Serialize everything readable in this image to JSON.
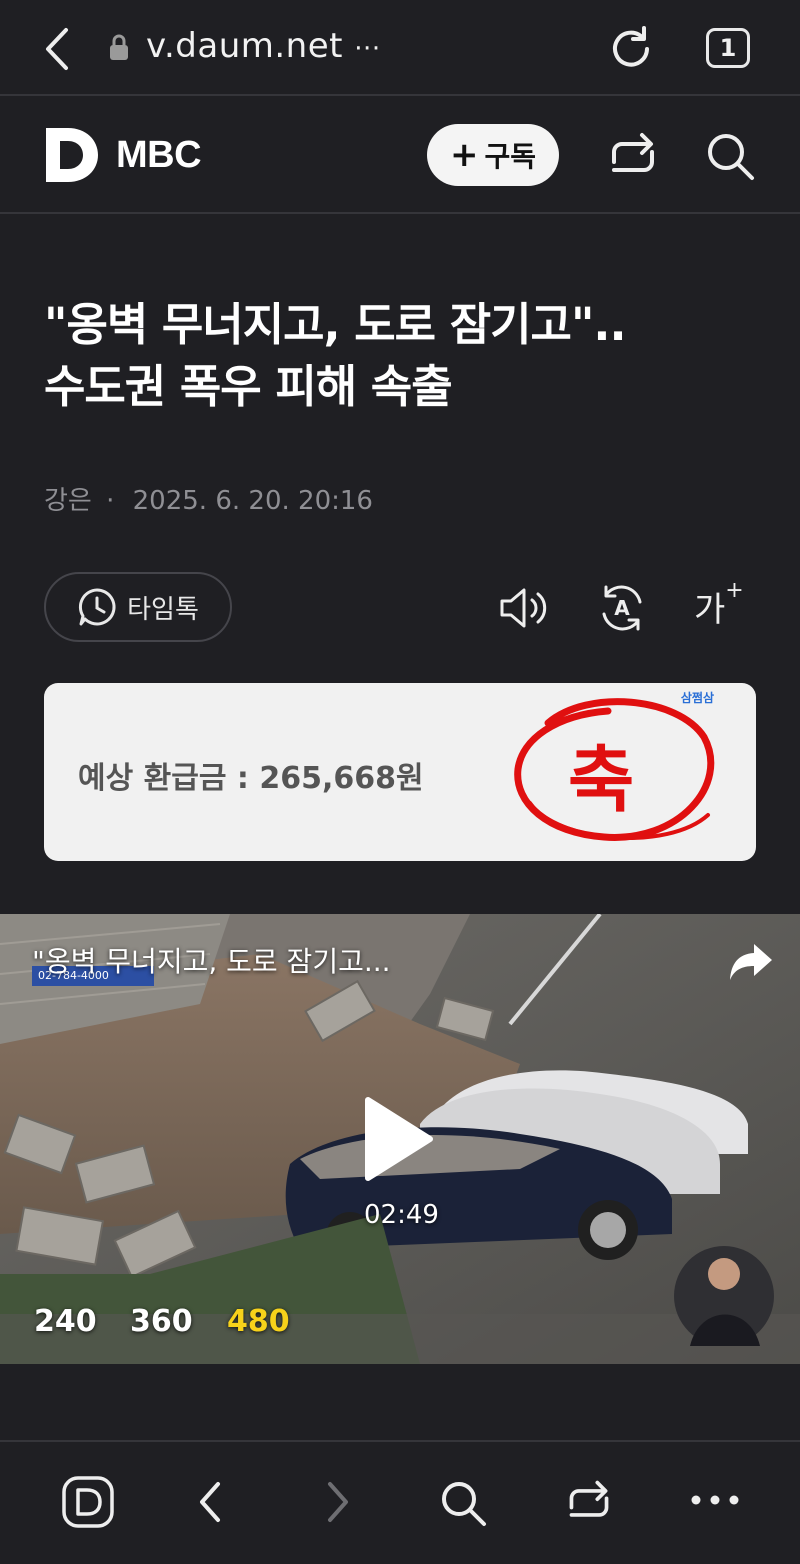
{
  "browser": {
    "url": "v.daum.net",
    "more_label": "···",
    "tab_count": "1"
  },
  "header": {
    "brand": "MBC",
    "subscribe_label": "구독"
  },
  "article": {
    "headline_line1": "\"옹벽 무너지고, 도로 잠기고\"..",
    "headline_line2": "수도권 폭우 피해 속출",
    "author": "강은",
    "date": "2025. 6. 20. 20:16"
  },
  "tools": {
    "timetalk_label": "타임톡",
    "font_size_label": "가"
  },
  "ad": {
    "text": "예상 환급금 : 265,668원",
    "badge_char": "축",
    "logo": "삼쩜삼"
  },
  "video": {
    "title": "\"옹벽 무너지고, 도로 잠기고...",
    "duration": "02:49",
    "phone_text": "02-784-4000",
    "quality_options": [
      {
        "label": "240",
        "color": "#ffffff"
      },
      {
        "label": "360",
        "color": "#ffffff"
      },
      {
        "label": "480",
        "color": "#f7d21a"
      }
    ]
  },
  "bottom_nav": [
    "daum-home",
    "back",
    "forward",
    "search",
    "share",
    "more"
  ]
}
